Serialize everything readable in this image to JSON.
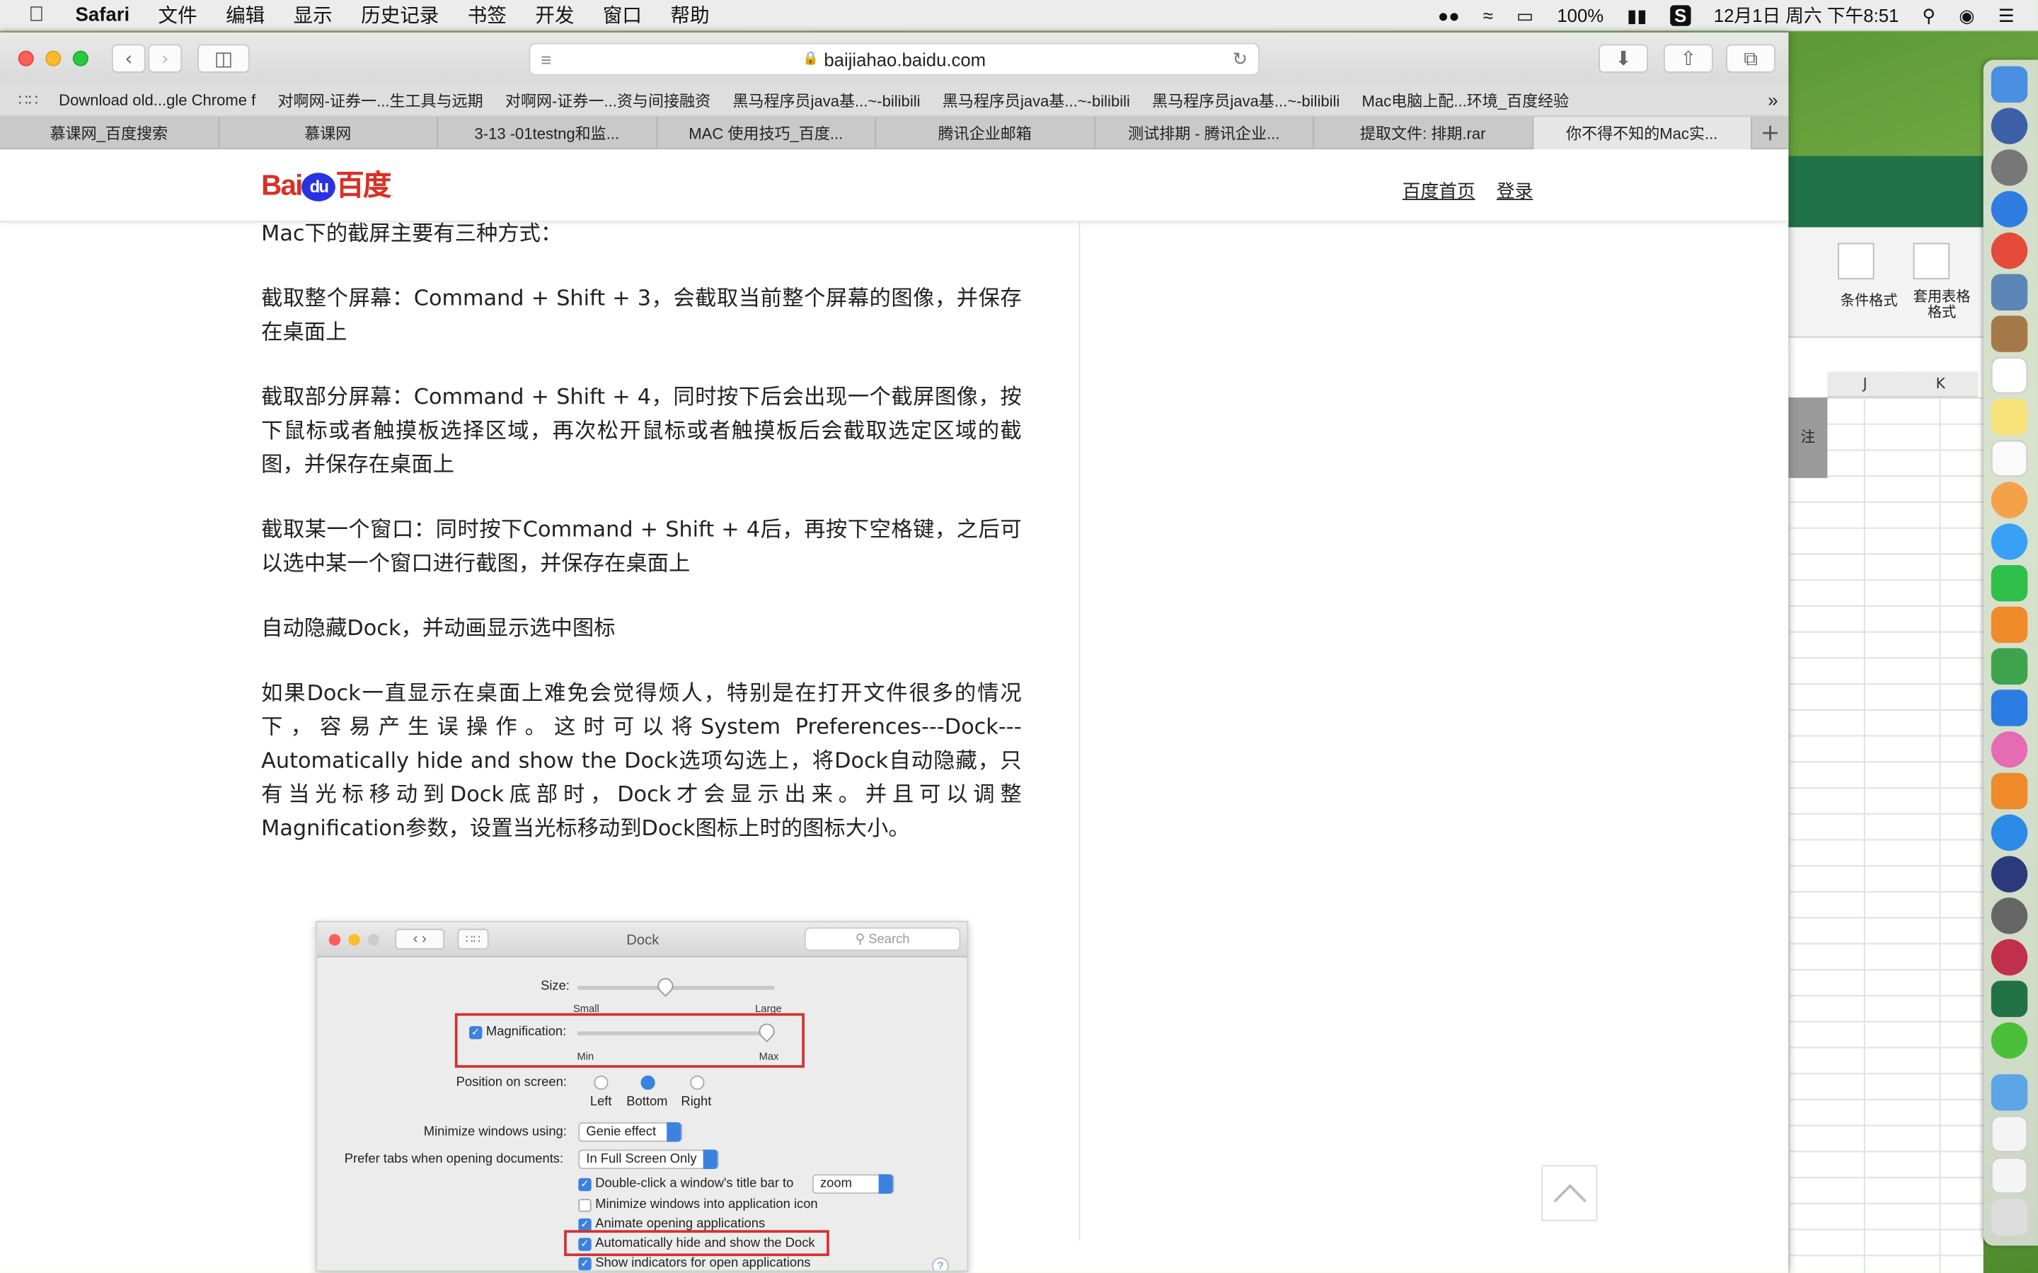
{
  "menubar": {
    "apple": "",
    "app": "Safari",
    "items": [
      "文件",
      "编辑",
      "显示",
      "历史记录",
      "书签",
      "开发",
      "窗口",
      "帮助"
    ],
    "battery": "100%",
    "datetime": "12月1日 周六 下午8:51"
  },
  "browser": {
    "url": "baijiahao.baidu.com",
    "bookmarks": [
      "Download old...gle Chrome f",
      "对啊网-证券一...生工具与远期",
      "对啊网-证券一...资与间接融资",
      "黑马程序员java基...~-bilibili",
      "黑马程序员java基...~-bilibili",
      "黑马程序员java基...~-bilibili",
      "Mac电脑上配...环境_百度经验"
    ],
    "tabs": [
      "慕课网_百度搜索",
      "慕课网",
      "3-13 -01testng和监...",
      "MAC 使用技巧_百度...",
      "腾讯企业邮箱",
      "测试排期 - 腾讯企业...",
      "提取文件: 排期.rar",
      "你不得不知的Mac实..."
    ],
    "active_tab": 7
  },
  "page": {
    "logo_bai": "Bai",
    "logo_du": "du",
    "logo_cn": "百度",
    "home_link": "百度首页",
    "login_link": "登录",
    "paragraphs": [
      "Mac下的截屏主要有三种方式：",
      "截取整个屏幕：Command + Shift + 3，会截取当前整个屏幕的图像，并保存在桌面上",
      "截取部分屏幕：Command + Shift + 4，同时按下后会出现一个截屏图像，按下鼠标或者触摸板选择区域，再次松开鼠标或者触摸板后会截取选定区域的截图，并保存在桌面上",
      "截取某一个窗口：同时按下Command + Shift + 4后，再按下空格键，之后可以选中某一个窗口进行截图，并保存在桌面上",
      "自动隐藏Dock，并动画显示选中图标",
      "如果Dock一直显示在桌面上难免会觉得烦人，特别是在打开文件很多的情况下，容易产生误操作。这时可以将System Preferences---Dock---Automatically hide and show the Dock选项勾选上，将Dock自动隐藏，只有当光标移动到Dock底部时，Dock才会显示出来。并且可以调整Magnification参数，设置当光标移动到Dock图标上时的图标大小。"
    ]
  },
  "dock_prefs": {
    "title": "Dock",
    "search": "Search",
    "size_label": "Size:",
    "small": "Small",
    "large": "Large",
    "magnification_label": "Magnification:",
    "min": "Min",
    "max": "Max",
    "position_label": "Position on screen:",
    "left": "Left",
    "bottom": "Bottom",
    "right": "Right",
    "minimize_label": "Minimize windows using:",
    "minimize_value": "Genie effect",
    "tabs_label": "Prefer tabs when opening documents:",
    "tabs_value": "In Full Screen Only",
    "dblclick": "Double-click a window's title bar to",
    "dblclick_value": "zoom",
    "minimize_into": "Minimize windows into application icon",
    "animate": "Animate opening applications",
    "autohide": "Automatically hide and show the Dock",
    "indicators": "Show indicators for open applications"
  },
  "excel": {
    "cond_format": "条件格式",
    "table_format": "套用表格格式",
    "col_j": "J",
    "col_k": "K",
    "note": "注"
  }
}
